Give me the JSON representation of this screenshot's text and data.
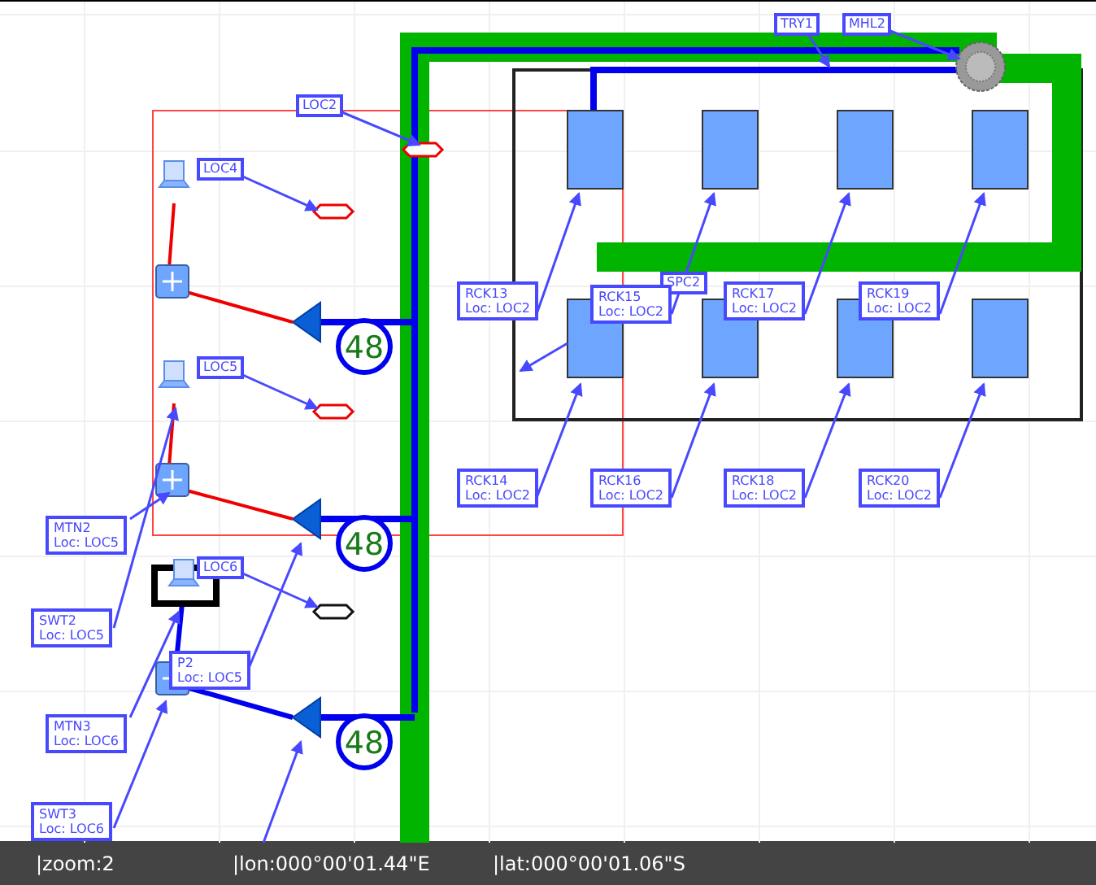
{
  "diagram": {
    "location_labels": [
      {
        "text": "LOC2"
      },
      {
        "text": "LOC4"
      },
      {
        "text": "LOC5"
      },
      {
        "text": "LOC6"
      },
      {
        "text": "TRY1"
      },
      {
        "text": "MHL2"
      },
      {
        "text": "SPC2"
      }
    ],
    "device_labels": [
      {
        "name": "RCK13",
        "location": "Loc: LOC2"
      },
      {
        "name": "RCK15",
        "location": "Loc: LOC2"
      },
      {
        "name": "RCK17",
        "location": "Loc: LOC2"
      },
      {
        "name": "RCK19",
        "location": "Loc: LOC2"
      },
      {
        "name": "RCK14",
        "location": "Loc: LOC2"
      },
      {
        "name": "RCK16",
        "location": "Loc: LOC2"
      },
      {
        "name": "RCK18",
        "location": "Loc: LOC2"
      },
      {
        "name": "RCK20",
        "location": "Loc: LOC2"
      },
      {
        "name": "MTN2",
        "location": "Loc: LOC5"
      },
      {
        "name": "SWT2",
        "location": "Loc: LOC5"
      },
      {
        "name": "P2",
        "location": "Loc: LOC5"
      },
      {
        "name": "MTN3",
        "location": "Loc: LOC6"
      },
      {
        "name": "SWT3",
        "location": "Loc: LOC6"
      }
    ],
    "cable_counts": [
      "48",
      "48",
      "48"
    ]
  },
  "status_bar": {
    "zoom": "|zoom:2",
    "lon": "|lon:000°00'01.44\"E",
    "lat": "|lat:000°00'01.06\"S"
  }
}
